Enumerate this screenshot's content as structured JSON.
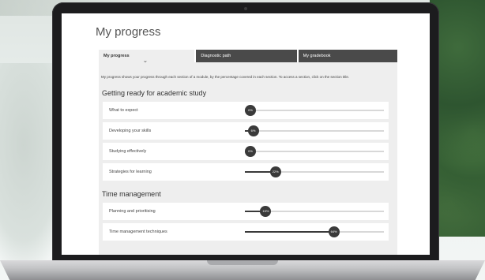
{
  "page": {
    "title": "My progress"
  },
  "tabs": [
    {
      "label": "My progress",
      "active": true
    },
    {
      "label": "Diagnostic path",
      "active": false
    },
    {
      "label": "My gradebook",
      "active": false
    }
  ],
  "intro_text": "My progress shows your progress through each section of a module, by the percentage covered in each section. To access a section, click on the section title.",
  "sections": [
    {
      "heading": "Getting ready for academic study",
      "items": [
        {
          "label": "What to expect",
          "percent_label": "0%",
          "progress": 0
        },
        {
          "label": "Developing your skills",
          "percent_label": "6%",
          "progress": 0.06
        },
        {
          "label": "Studying effectively",
          "percent_label": "0%",
          "progress": 0
        },
        {
          "label": "Strategies for learning",
          "percent_label": "22%",
          "progress": 0.22
        }
      ]
    },
    {
      "heading": "Time management",
      "items": [
        {
          "label": "Planning and prioritising",
          "percent_label": "15%",
          "progress": 0.15
        },
        {
          "label": "Time management techniques",
          "percent_label": "64%",
          "progress": 0.64
        }
      ]
    }
  ],
  "colors": {
    "tab_dark": "#4a4a4a",
    "panel_bg": "#eeeeee",
    "slider": "#3a3a3a"
  },
  "icons": {
    "tab_chevron": "chevron-down-icon"
  }
}
